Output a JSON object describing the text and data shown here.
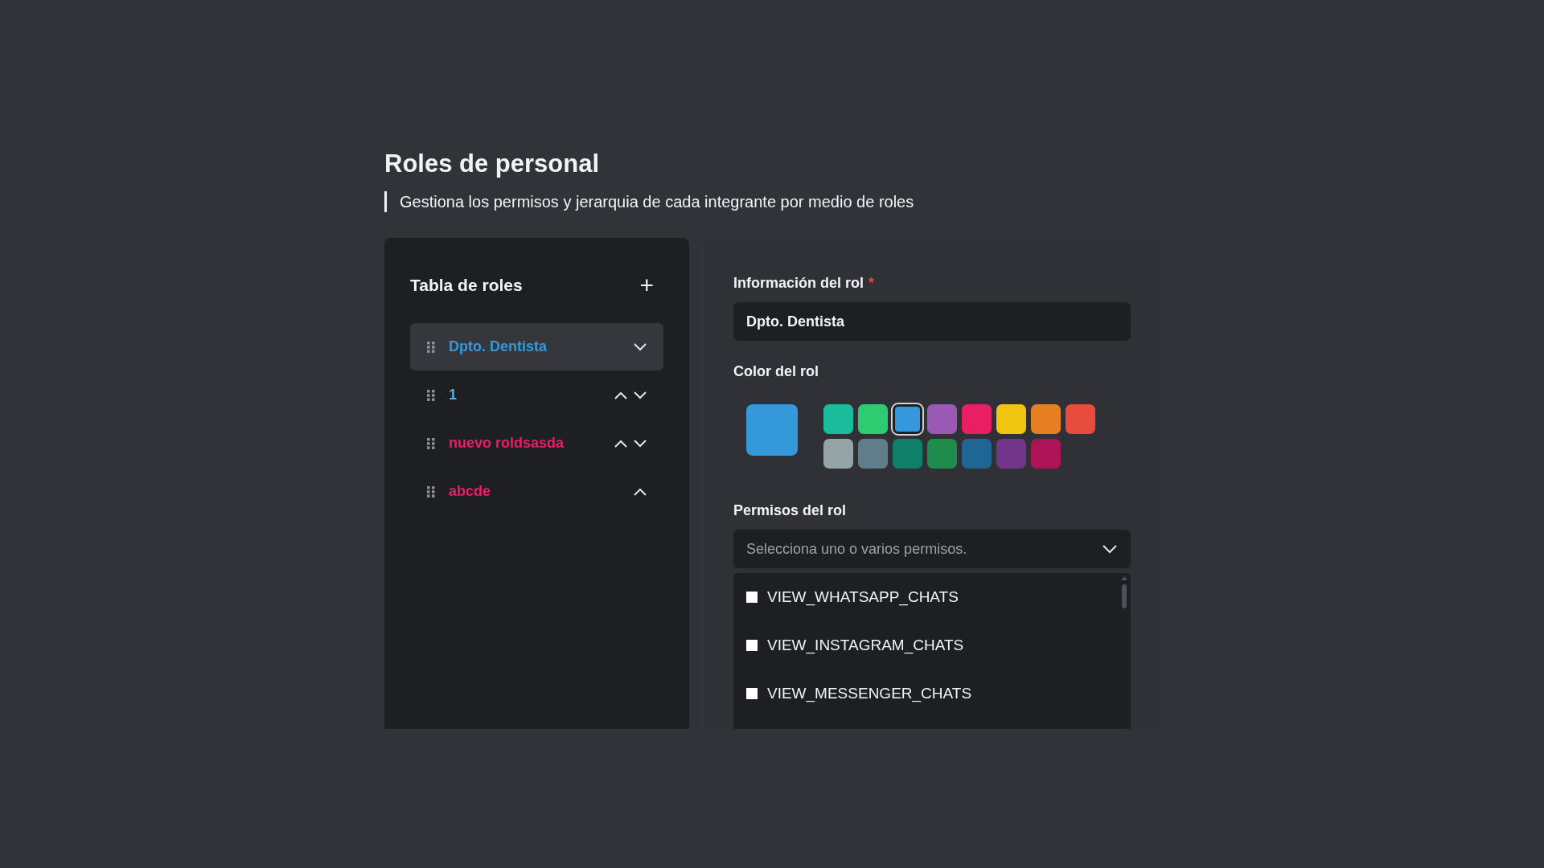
{
  "header": {
    "title": "Roles de personal",
    "subtitle": "Gestiona los permisos y jerarquia de cada integrante por medio de roles"
  },
  "roles_table": {
    "title": "Tabla de roles",
    "add_icon": "+",
    "roles": [
      {
        "name": "Dpto. Dentista",
        "color": "#3498db",
        "selected": true,
        "can_move_up": false,
        "can_move_down": true
      },
      {
        "name": "1",
        "color": "#5dade2",
        "selected": false,
        "can_move_up": true,
        "can_move_down": true
      },
      {
        "name": "nuevo roldsasda",
        "color": "#e91e63",
        "selected": false,
        "can_move_up": true,
        "can_move_down": true
      },
      {
        "name": "abcde",
        "color": "#e91e63",
        "selected": false,
        "can_move_up": true,
        "can_move_down": false
      }
    ]
  },
  "role_info": {
    "label": "Información del rol",
    "required_mark": "*",
    "value": "Dpto. Dentista"
  },
  "role_color": {
    "label": "Color del rol",
    "swatch_rows": [
      [
        {
          "color": "#1abc9c",
          "selected": false
        },
        {
          "color": "#2ecc71",
          "selected": false
        },
        {
          "color": "#3498db",
          "selected": true
        },
        {
          "color": "#9b59b6",
          "selected": false
        },
        {
          "color": "#e91e63",
          "selected": false
        },
        {
          "color": "#f1c40f",
          "selected": false
        },
        {
          "color": "#e67e22",
          "selected": false
        },
        {
          "color": "#e74c3c",
          "selected": false
        }
      ],
      [
        {
          "color": "#95a5a6",
          "selected": false
        },
        {
          "color": "#607d8b",
          "selected": false
        },
        {
          "color": "#11806a",
          "selected": false
        },
        {
          "color": "#1f8b4c",
          "selected": false
        },
        {
          "color": "#206694",
          "selected": false
        },
        {
          "color": "#71368a",
          "selected": false
        },
        {
          "color": "#ad1457",
          "selected": false
        }
      ]
    ]
  },
  "permissions": {
    "label": "Permisos del rol",
    "placeholder": "Selecciona uno o varios permisos.",
    "options": [
      {
        "label": "VIEW_WHATSAPP_CHATS",
        "checked": false
      },
      {
        "label": "VIEW_INSTAGRAM_CHATS",
        "checked": false
      },
      {
        "label": "VIEW_MESSENGER_CHATS",
        "checked": false
      }
    ]
  }
}
